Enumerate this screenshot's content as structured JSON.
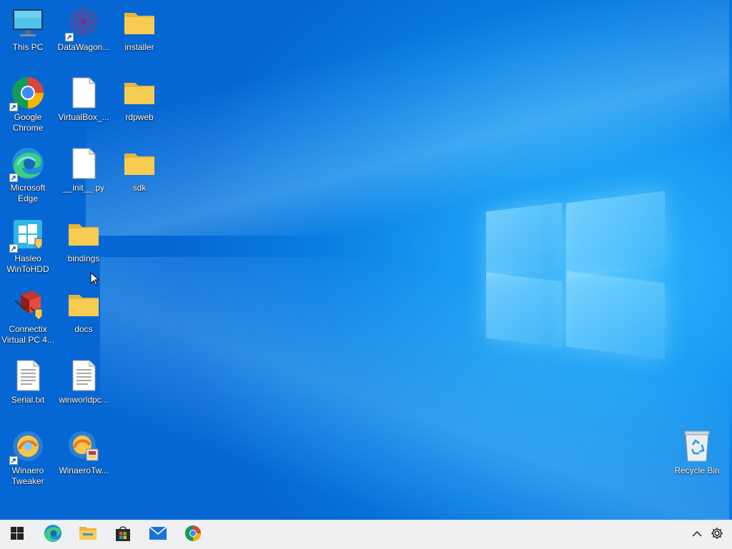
{
  "desktop": {
    "icons": {
      "this_pc": "This PC",
      "datawagon": "DataWagon...",
      "installer": "installer",
      "chrome": "Google Chrome",
      "virtualbox": "VirtualBox_...",
      "rdpweb": "rdpweb",
      "edge": "Microsoft Edge",
      "init_py": "__init__.py",
      "sdk": "sdk",
      "hasleo": "Hasleo WinToHDD",
      "bindings": "bindings",
      "connectix": "Connectix Virtual PC 4...",
      "docs": "docs",
      "serial": "Serial.txt",
      "winworldpc": "winworldpc...",
      "winaero": "Winaero Tweaker",
      "winaerotw": "WinaeroTw...",
      "recycle_bin": "Recycle Bin"
    }
  },
  "taskbar": {
    "buttons": [
      "start-icon",
      "edge-icon",
      "file-explorer-icon",
      "store-icon",
      "mail-icon",
      "chrome-icon"
    ],
    "tray": [
      "show-hidden-icons-chevron",
      "settings-gear-icon"
    ]
  },
  "colors": {
    "wallpaper": "#0a7fe3",
    "taskbar": "#eef0f2",
    "folder": "#f6cc53"
  }
}
